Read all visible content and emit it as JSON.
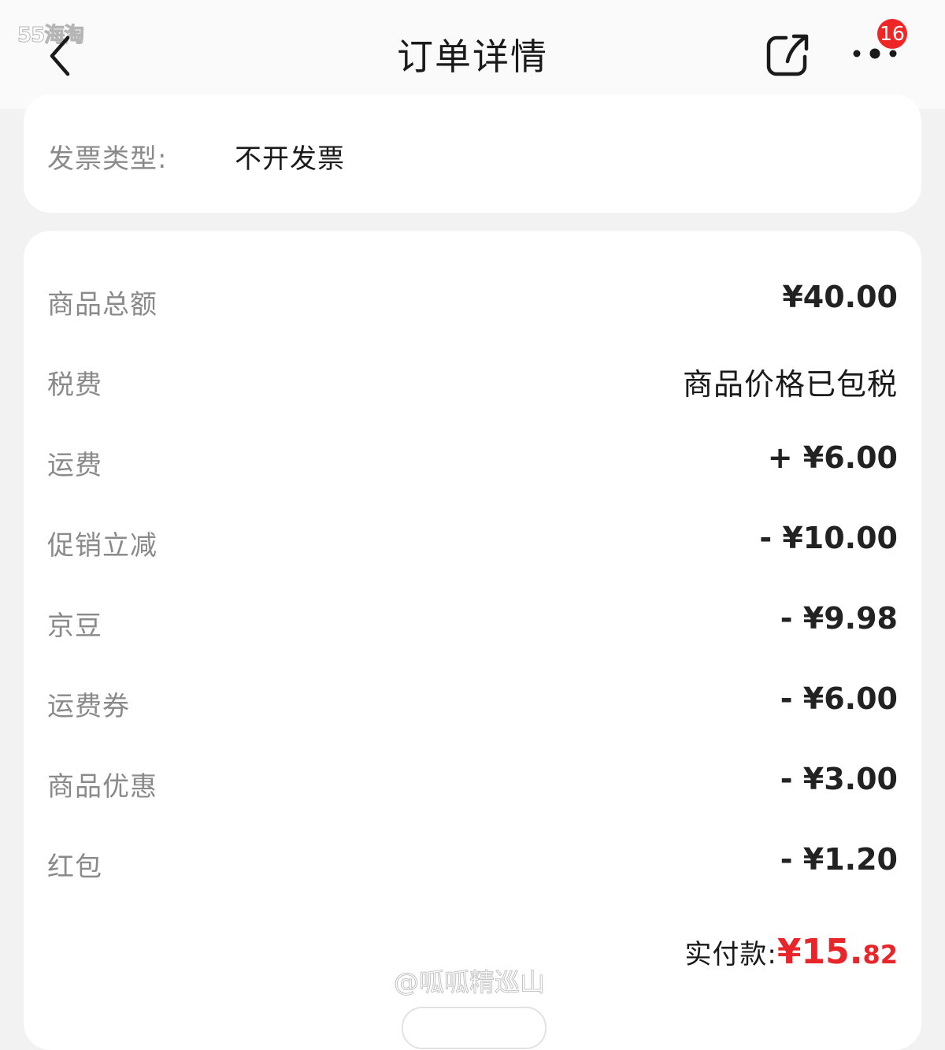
{
  "header": {
    "watermark": "55海淘",
    "title": "订单详情",
    "back_icon": "chevron-left-icon",
    "share_icon": "share-icon",
    "more_icon": "more-dots-icon",
    "badge_count": "16",
    "badge_color": "#ee2626"
  },
  "invoice": {
    "label": "发票类型:",
    "value": "不开发票"
  },
  "costs": {
    "rows": [
      {
        "label": "商品总额",
        "value": "¥40.00"
      },
      {
        "label": "税费",
        "value": "商品价格已包税"
      },
      {
        "label": "运费",
        "value": "+ ¥6.00"
      },
      {
        "label": "促销立减",
        "value": "- ¥10.00"
      },
      {
        "label": "京豆",
        "value": "- ¥9.98"
      },
      {
        "label": "运费券",
        "value": "- ¥6.00"
      },
      {
        "label": "商品优惠",
        "value": "- ¥3.00"
      },
      {
        "label": "红包",
        "value": "- ¥1.20"
      }
    ],
    "total": {
      "label": "实付款:",
      "int": "¥15.",
      "dec": "82",
      "color": "#e8262a"
    }
  },
  "watermark_bottom": "@呱呱精巡山"
}
